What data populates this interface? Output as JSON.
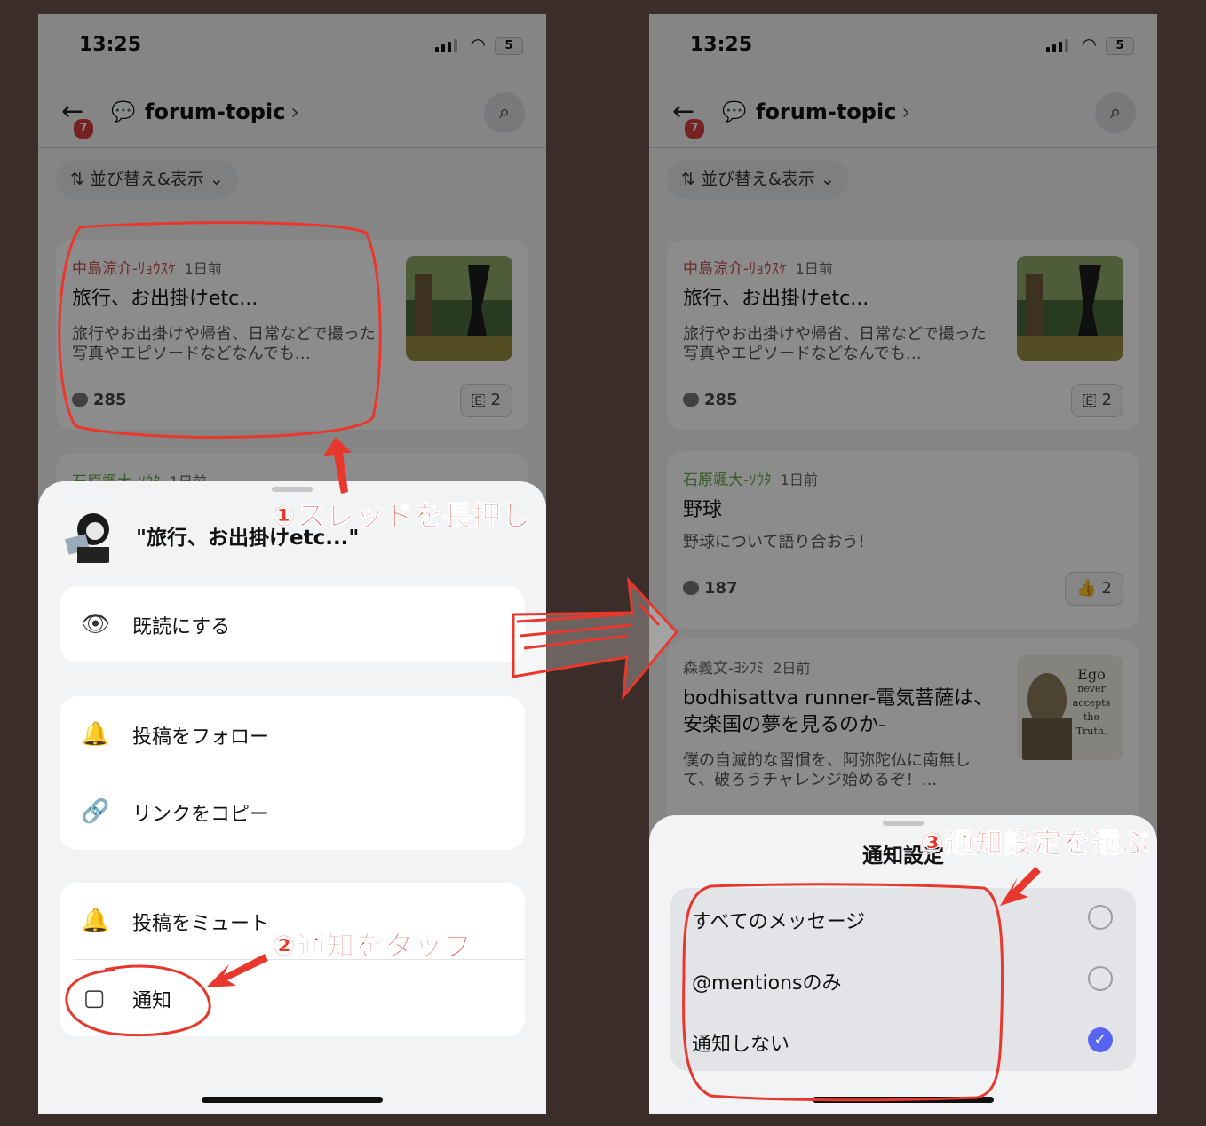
{
  "status": {
    "time": "13:25",
    "battery": "5"
  },
  "header": {
    "channel": "forum-topic",
    "chevron": "›",
    "badge": "7"
  },
  "sort": {
    "label": "並び替え&表示"
  },
  "posts": [
    {
      "author": "中島涼介-ﾘｮｳｽｹ",
      "author_color": "#c0504d",
      "ago": "1日前",
      "title": "旅行、お出掛けetc...",
      "desc": "旅行やお出掛けや帰省、日常などで撮った写真やエピソードなどなんでも…",
      "count": "285",
      "reaction": "🇪",
      "reaction_count": "2"
    },
    {
      "author": "石原颯大-ｿｳﾀ",
      "author_color": "#6aa84f",
      "ago": "1日前",
      "title": "野球",
      "desc": "野球について語り合おう!",
      "count": "187",
      "reaction": "👍",
      "reaction_count": "2"
    },
    {
      "author": "森義文-ﾖｼﾌﾐ",
      "author_color": "#666666",
      "ago": "2日前",
      "title": "bodhisattva runner-電気菩薩は、安楽国の夢を見るのか-",
      "desc": "僕の自滅的な習慣を、阿弥陀仏に南無して、破ろうチャレンジ始めるぞ！...",
      "thumb_text": [
        "Ego",
        "never",
        "accepts",
        "the Truth."
      ]
    }
  ],
  "context_menu": {
    "thread_title": "\"旅行、お出掛けetc...\"",
    "mark_read": "既読にする",
    "follow": "投稿をフォロー",
    "copy_link": "リンクをコピー",
    "mute": "投稿をミュート",
    "notify": "通知"
  },
  "notify_sheet": {
    "title": "通知設定",
    "options": [
      {
        "label": "すべてのメッセージ",
        "selected": false
      },
      {
        "label": "@mentionsのみ",
        "selected": false
      },
      {
        "label": "通知しない",
        "selected": true
      }
    ]
  },
  "annotations": {
    "step1": "①スレッドを長押し",
    "step2": "②通知をタップ",
    "step3": "③通知設定を選ぶ"
  }
}
